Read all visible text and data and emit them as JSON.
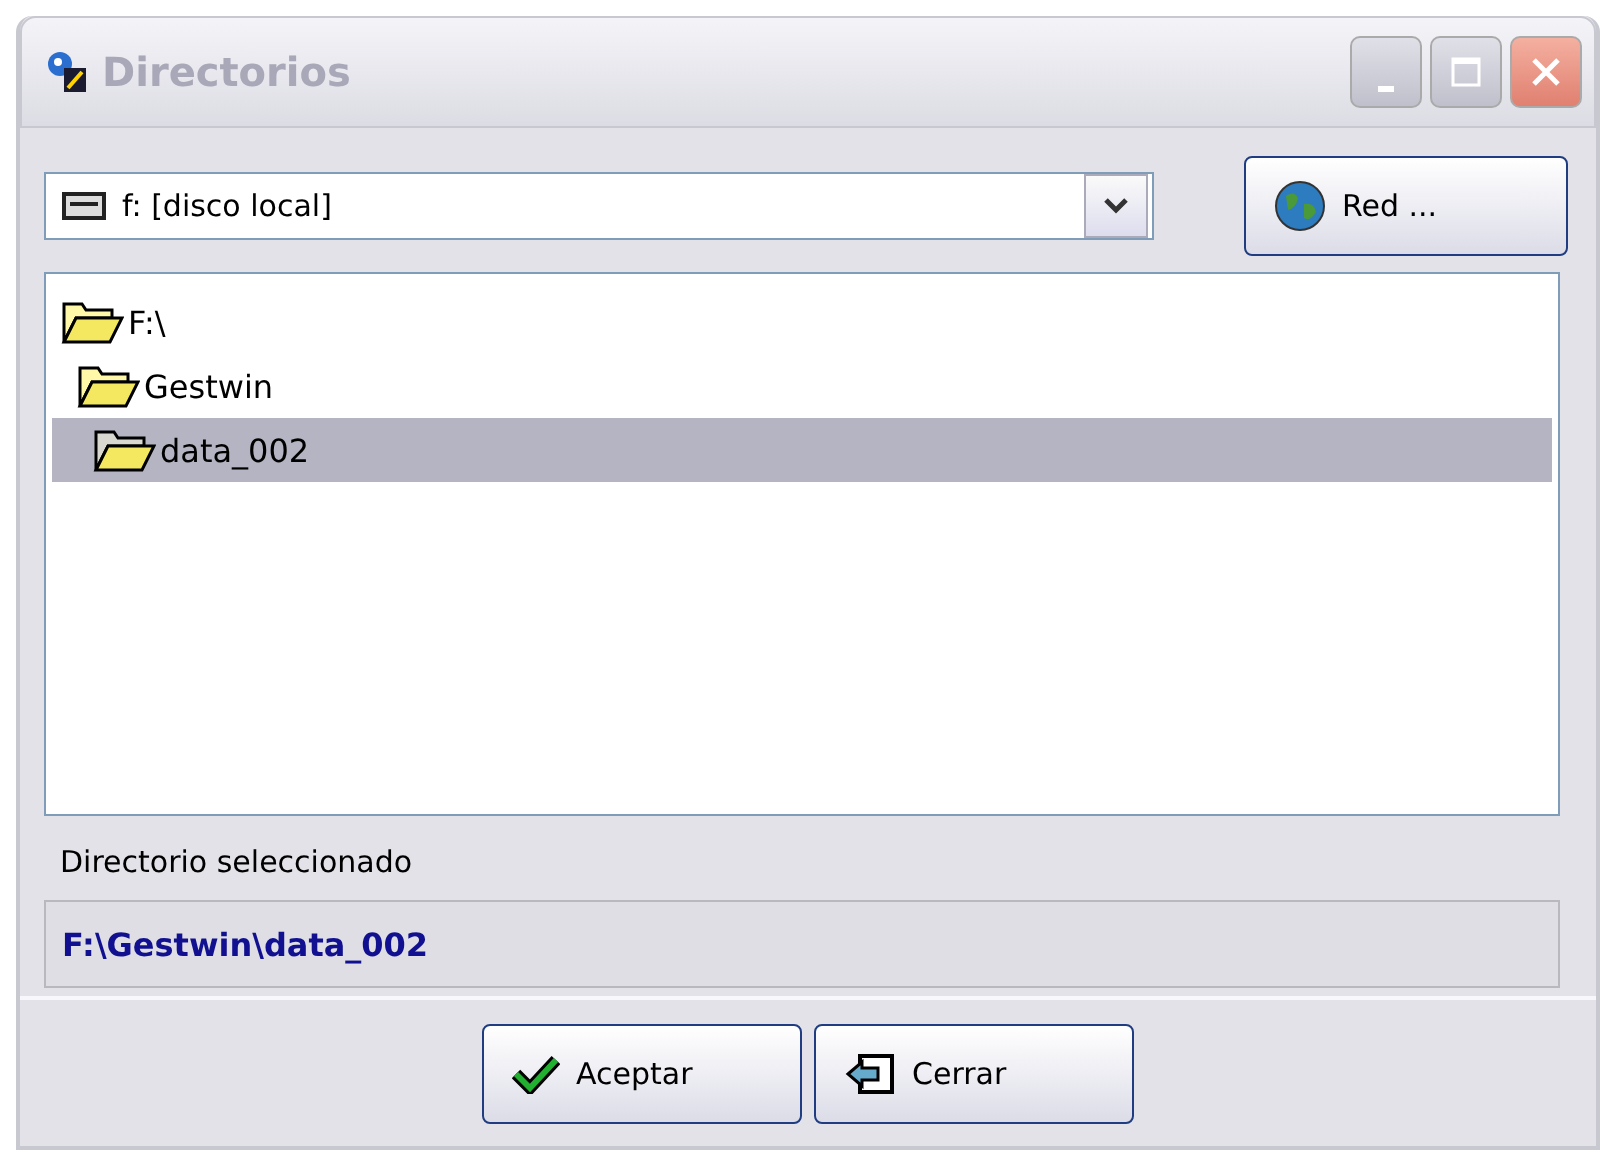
{
  "window": {
    "title": "Directorios"
  },
  "drive_select": {
    "value": "f: [disco local]"
  },
  "network_button": {
    "label": "Red ..."
  },
  "tree": [
    {
      "label": "F:\\",
      "selected": false,
      "children": [
        {
          "label": "Gestwin",
          "selected": false,
          "children": [
            {
              "label": "data_002",
              "selected": true
            }
          ]
        }
      ]
    }
  ],
  "selected_label": "Directorio seleccionado",
  "selected_path": "F:\\Gestwin\\data_002",
  "buttons": [
    {
      "kind": "accept",
      "label": "Aceptar"
    },
    {
      "kind": "close",
      "label": "Cerrar"
    }
  ]
}
